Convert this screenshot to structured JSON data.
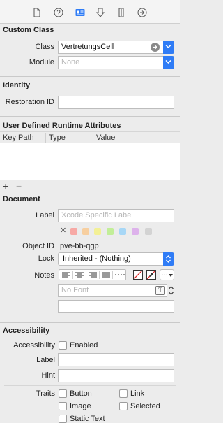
{
  "toolbar": {
    "icons": [
      "file-icon",
      "help-icon",
      "identity-icon",
      "attributes-icon",
      "size-icon",
      "connections-icon"
    ]
  },
  "custom_class": {
    "title": "Custom Class",
    "class_label": "Class",
    "class_value": "VertretungsCell",
    "module_label": "Module",
    "module_placeholder": "None"
  },
  "identity": {
    "title": "Identity",
    "restoration_label": "Restoration ID",
    "restoration_value": ""
  },
  "runtime": {
    "title": "User Defined Runtime Attributes",
    "columns": [
      "Key Path",
      "Type",
      "Value"
    ],
    "add_label": "+",
    "remove_label": "−"
  },
  "document": {
    "title": "Document",
    "label_label": "Label",
    "label_placeholder": "Xcode Specific Label",
    "clear_label": "✕",
    "colors": [
      "#f7a9a5",
      "#f7cfa0",
      "#f3f096",
      "#c2ee98",
      "#a7d7f6",
      "#ddb2eb",
      "#d3d3d3"
    ],
    "object_id_label": "Object ID",
    "object_id_value": "pve-bb-qgp",
    "lock_label": "Lock",
    "lock_value": "Inherited - (Nothing)",
    "notes_label": "Notes",
    "font_placeholder": "No Font",
    "font_button": "T",
    "more_label": "..."
  },
  "accessibility": {
    "title": "Accessibility",
    "accessibility_label": "Accessibility",
    "enabled_label": "Enabled",
    "label_label": "Label",
    "hint_label": "Hint",
    "traits_label": "Traits",
    "traits": [
      {
        "label": "Button"
      },
      {
        "label": "Link"
      },
      {
        "label": "Image"
      },
      {
        "label": "Selected"
      },
      {
        "label": "Static Text"
      }
    ]
  },
  "colors": {
    "accent": "#2f7cf6"
  }
}
